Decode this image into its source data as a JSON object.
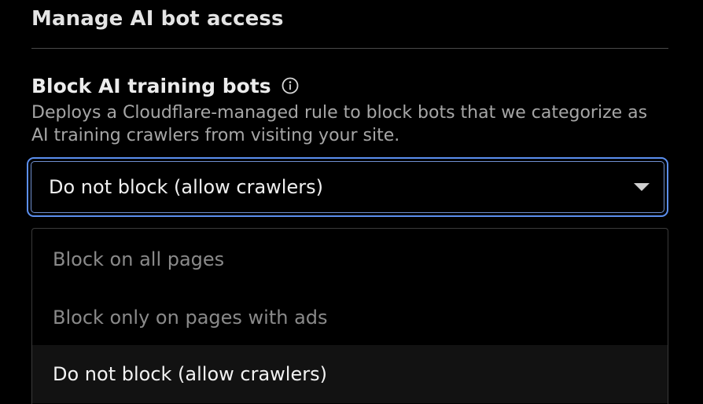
{
  "section": {
    "title": "Manage AI bot access"
  },
  "setting": {
    "label": "Block AI training bots",
    "info_icon": "info-icon",
    "description": "Deploys a Cloudflare-managed rule to block bots that we categorize as AI training crawlers from visiting your site."
  },
  "select": {
    "value": "Do not block (allow crawlers)",
    "chevron_icon": "chevron-down-icon",
    "focus_color": "#5b8fef"
  },
  "dropdown": {
    "options": [
      {
        "label": "Block on all pages",
        "state": "disabled"
      },
      {
        "label": "Block only on pages with ads",
        "state": "disabled"
      },
      {
        "label": "Do not block (allow crawlers)",
        "state": "selected"
      }
    ]
  }
}
